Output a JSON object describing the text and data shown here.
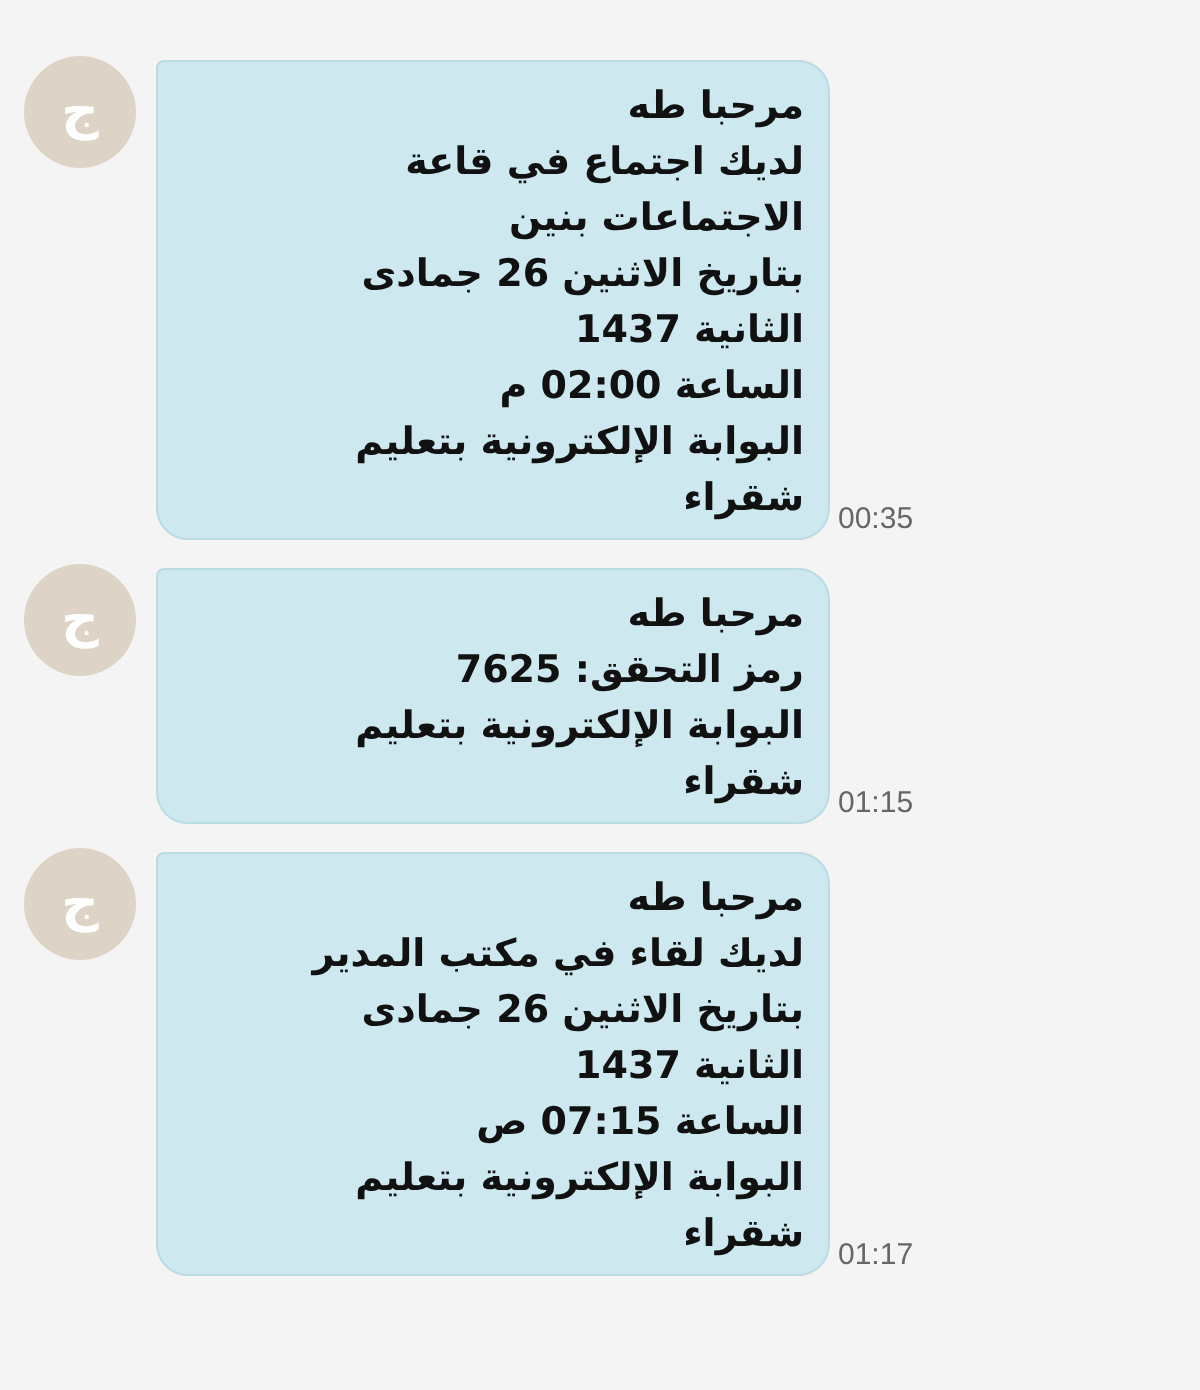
{
  "messages": [
    {
      "avatar": "ج",
      "lines": [
        "مرحبا طه",
        "لديك اجتماع في قاعة",
        "الاجتماعات بنين",
        "بتاريخ الاثنين 26 جمادى",
        "الثانية 1437",
        "الساعة 02:00 م",
        "البوابة الإلكترونية بتعليم",
        "شقراء"
      ],
      "time": "00:35"
    },
    {
      "avatar": "ج",
      "lines": [
        "مرحبا طه",
        "رمز التحقق: 7625",
        "البوابة الإلكترونية بتعليم",
        "شقراء"
      ],
      "time": "01:15"
    },
    {
      "avatar": "ج",
      "lines": [
        "مرحبا طه",
        "لديك لقاء في مكتب المدير",
        "بتاريخ الاثنين 26 جمادى",
        "الثانية 1437",
        "الساعة 07:15 ص",
        "البوابة الإلكترونية بتعليم",
        "شقراء"
      ],
      "time": "01:17"
    }
  ]
}
